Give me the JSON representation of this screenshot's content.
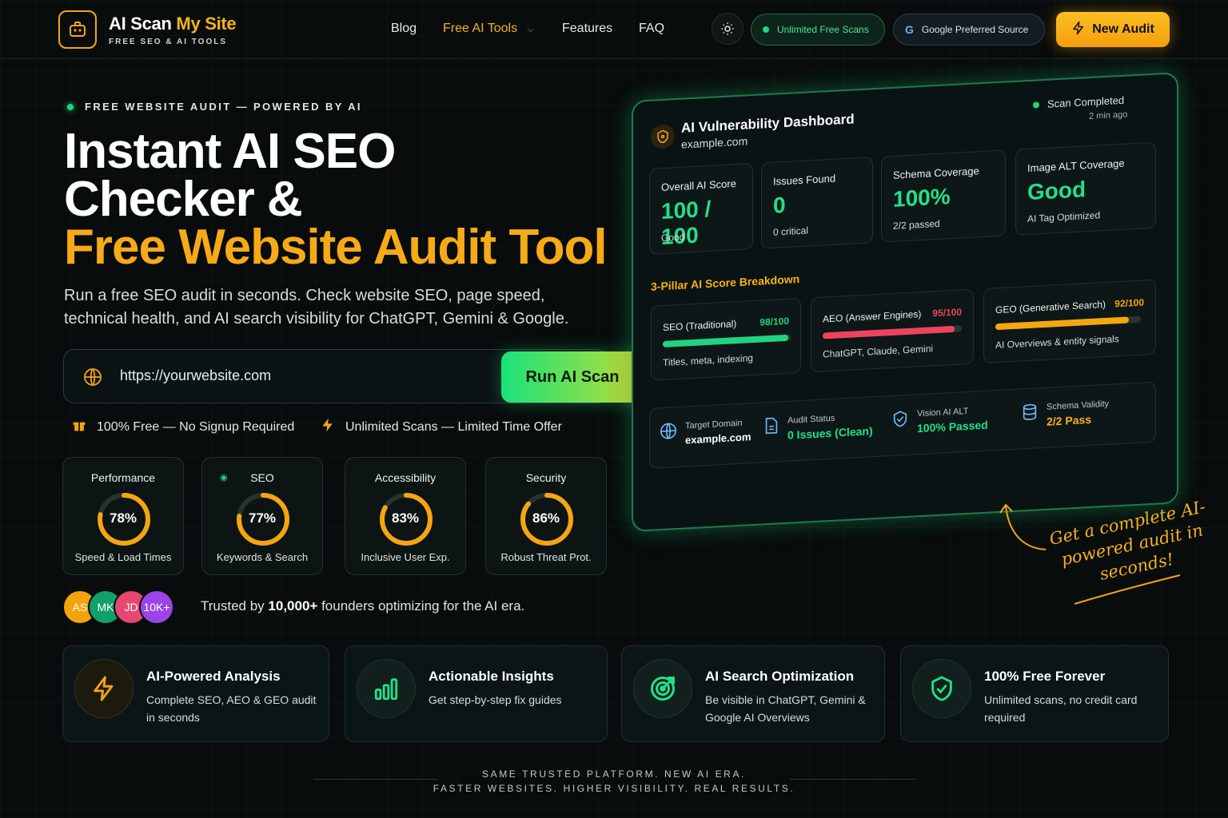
{
  "nav": {
    "brand_main": "AI Scan ",
    "brand_highlight": "My Site",
    "brand_tagline": "FREE SEO & AI TOOLS",
    "links": [
      "Blog",
      "Free AI Tools",
      "Features",
      "FAQ"
    ],
    "pill_unlimited": "Unlimited Free Scans",
    "pill_google": "Google Preferred Source",
    "new_audit": "New Audit"
  },
  "hero": {
    "eyebrow": "FREE WEBSITE AUDIT — POWERED BY AI",
    "title_line1": "Instant AI SEO",
    "title_line2": "Checker &",
    "title_line3": "Free Website Audit Tool",
    "lead": "Run a free SEO audit in seconds. Check website SEO, page speed, technical health, and AI search visibility for ChatGPT, Gemini & Google.",
    "search_placeholder": "https://yourwebsite.com",
    "run_button": "Run AI Scan",
    "perk_free": "100% Free — No Signup Required",
    "perk_unlimited": "Unlimited Scans — Limited Time Offer"
  },
  "scores": [
    {
      "title": "Performance",
      "value": "78%",
      "pct": 78,
      "sub": "Speed & Load Times"
    },
    {
      "title": "SEO",
      "value": "77%",
      "pct": 77,
      "sub": "Keywords & Search"
    },
    {
      "title": "Accessibility",
      "value": "83%",
      "pct": 83,
      "sub": "Inclusive User Exp."
    },
    {
      "title": "Security",
      "value": "86%",
      "pct": 86,
      "sub": "Robust Threat Prot."
    }
  ],
  "trust": {
    "avatars": [
      "AS",
      "MK",
      "JD",
      "10K+"
    ],
    "avatar_colors": [
      "#f5a30b",
      "#10a06a",
      "#e54870",
      "#9b45e6"
    ],
    "prefix": "Trusted by ",
    "count": "10,000+",
    "suffix": " founders optimizing for the AI era."
  },
  "dashboard": {
    "title": "AI Vulnerability Dashboard",
    "domain": "example.com",
    "status": "Scan Completed",
    "time": "2 min ago",
    "stats": [
      {
        "title": "Overall AI Score",
        "value": "100 / 100",
        "sub": "Good"
      },
      {
        "title": "Issues Found",
        "value": "0",
        "sub": "0 critical"
      },
      {
        "title": "Schema Coverage",
        "value": "100%",
        "sub": "2/2 passed"
      },
      {
        "title": "Image ALT Coverage",
        "value": "Good",
        "sub": "AI Tag Optimized"
      }
    ],
    "pillar_heading": "3-Pillar AI Score Breakdown",
    "pillars": [
      {
        "name": "SEO (Traditional)",
        "score": "98/100",
        "pct": 98,
        "color": "#20d47f",
        "sub": "Titles, meta, indexing"
      },
      {
        "name": "AEO (Answer Engines)",
        "score": "95/100",
        "pct": 95,
        "color": "#f0425f",
        "sub": "ChatGPT, Claude, Gemini"
      },
      {
        "name": "GEO (Generative Search)",
        "score": "92/100",
        "pct": 92,
        "color": "#f5a70f",
        "sub": "AI Overviews & entity signals"
      }
    ],
    "footer": [
      {
        "label": "Target Domain",
        "value": "example.com"
      },
      {
        "label": "Audit Status",
        "value": "0 Issues (Clean)"
      },
      {
        "label": "Vision AI ALT",
        "value": "100% Passed"
      },
      {
        "label": "Schema Validity",
        "value": "2/2 Pass"
      }
    ]
  },
  "annotation": "Get a complete AI-powered audit in seconds!",
  "features": [
    {
      "title": "AI-Powered Analysis",
      "desc": "Complete SEO, AEO & GEO audit in seconds"
    },
    {
      "title": "Actionable Insights",
      "desc": "Get step-by-step fix guides"
    },
    {
      "title": "AI Search Optimization",
      "desc": "Be visible in ChatGPT, Gemini & Google AI Overviews"
    },
    {
      "title": "100% Free Forever",
      "desc": "Unlimited scans, no credit card required"
    }
  ],
  "tagline": {
    "line1": "SAME TRUSTED PLATFORM. NEW AI ERA.",
    "line2": "FASTER WEBSITES. HIGHER VISIBILITY. REAL RESULTS."
  }
}
